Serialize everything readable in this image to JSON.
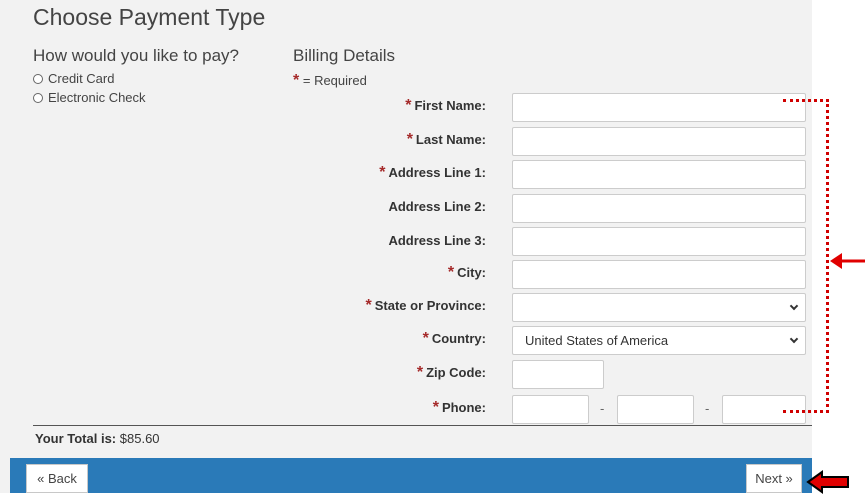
{
  "page": {
    "title": "Choose Payment Type"
  },
  "payment_method": {
    "heading": "How would you like to pay?",
    "options": [
      "Credit Card",
      "Electronic Check"
    ]
  },
  "billing": {
    "heading": "Billing Details",
    "required_marker": "*",
    "required_note": "= Required",
    "fields": {
      "first_name": {
        "label": "First Name:",
        "required": true,
        "value": ""
      },
      "last_name": {
        "label": "Last Name:",
        "required": true,
        "value": ""
      },
      "address1": {
        "label": "Address Line 1:",
        "required": true,
        "value": ""
      },
      "address2": {
        "label": "Address Line 2:",
        "required": false,
        "value": ""
      },
      "address3": {
        "label": "Address Line 3:",
        "required": false,
        "value": ""
      },
      "city": {
        "label": "City:",
        "required": true,
        "value": ""
      },
      "state": {
        "label": "State or Province:",
        "required": true,
        "selected": ""
      },
      "country": {
        "label": "Country:",
        "required": true,
        "selected": "United States of America"
      },
      "zip": {
        "label": "Zip Code:",
        "required": true,
        "value": ""
      },
      "phone": {
        "label": "Phone:",
        "required": true,
        "separator": "-"
      }
    }
  },
  "total": {
    "label": "Your Total is:",
    "amount": "$85.60"
  },
  "nav": {
    "back_label": "« Back",
    "next_label": "Next »"
  },
  "colors": {
    "footer": "#2a7ab8",
    "required": "#a52a2a",
    "annotation": "#d00000"
  }
}
